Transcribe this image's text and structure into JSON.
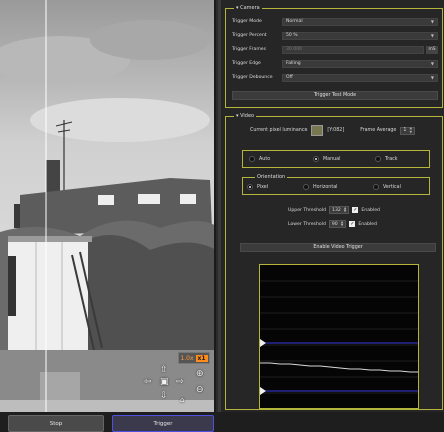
{
  "camera": {
    "section_title": "Camera",
    "fields": [
      {
        "label": "Trigger Mode",
        "value": "Normal"
      },
      {
        "label": "Trigger Percent",
        "value": "50 %"
      },
      {
        "label": "Trigger Frames",
        "value": "30.000",
        "unit": "mS"
      },
      {
        "label": "Trigger Edge",
        "value": "Falling"
      },
      {
        "label": "Trigger Debounce",
        "value": "Off"
      }
    ],
    "test_button": "Trigger Test Mode"
  },
  "video": {
    "section_title": "Video",
    "luminance_label": "Current pixel luminance",
    "luminance_hex": "[Y:082]",
    "luminance_color": "#787850",
    "frame_average_label": "Frame Average",
    "frame_average_value": "1",
    "modes": [
      {
        "label": "Auto",
        "selected": false
      },
      {
        "label": "Manual",
        "selected": true
      },
      {
        "label": "Track",
        "selected": false
      }
    ],
    "orientation_title": "Orientation",
    "orientations": [
      {
        "label": "Pixel",
        "selected": true
      },
      {
        "label": "Horizontal",
        "selected": false
      },
      {
        "label": "Vertical",
        "selected": false
      }
    ],
    "upper_threshold_label": "Upper Threshold",
    "upper_threshold_value": "132",
    "lower_threshold_label": "Lower Threshold",
    "lower_threshold_value": "90",
    "enabled_label": "Enabled",
    "enable_trigger_button": "Enable Video Trigger"
  },
  "preview": {
    "zoom_label": "1.0x",
    "zoom_badge": "x1"
  },
  "bottom": {
    "stop_label": "Stop",
    "trigger_label": "Trigger"
  },
  "colors": {
    "group_border": "#b5b53a",
    "trace": "#d8d8d8",
    "threshold_line": "#3c3ce0",
    "trigger_accent": "#5050e0"
  }
}
